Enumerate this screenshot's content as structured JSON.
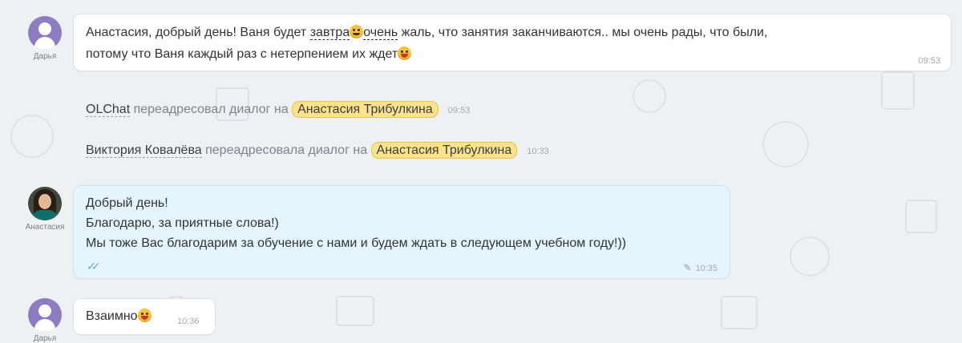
{
  "messages": [
    {
      "author": "Дарья",
      "text_before": "Анастасия, добрый день! Ваня будет ",
      "underline_1": "завтра",
      "underline_2": "очень",
      "text_after_line1": " жаль, что занятия заканчиваются.. мы очень рады, что были,",
      "line2": "потому что Ваня каждый раз с нетерпением их ждет",
      "time": "09:53"
    },
    {
      "author": "Анастасия",
      "lines": [
        "Добрый день!",
        "Благодарю, за приятные слова!)",
        "Мы тоже Вас благодарим за обучение с нами и будем ждать в следующем учебном году!))"
      ],
      "time": "10:35"
    },
    {
      "author": "Дарья",
      "text": "Взаимно",
      "time": "10:36"
    }
  ],
  "system": [
    {
      "who": "OLChat",
      "action": " переадресовал диалог на ",
      "target": "Анастасия Трибулкина",
      "time": "09:53"
    },
    {
      "who": "Виктория Ковалёва",
      "action": " переадресовала диалог на ",
      "target": "Анастасия Трибулкина",
      "time": "10:33"
    }
  ],
  "icons": {
    "emoji_1": "smiling-face-icon",
    "emoji_2": "grinning-face-icon",
    "read_receipt": "double-check-icon",
    "edited": "pencil-icon"
  },
  "colors": {
    "background": "#eef1f4",
    "outgoing_bubble": "#e6f4fb",
    "tag": "#fce28a",
    "avatar_default": "#8e7cc3"
  }
}
